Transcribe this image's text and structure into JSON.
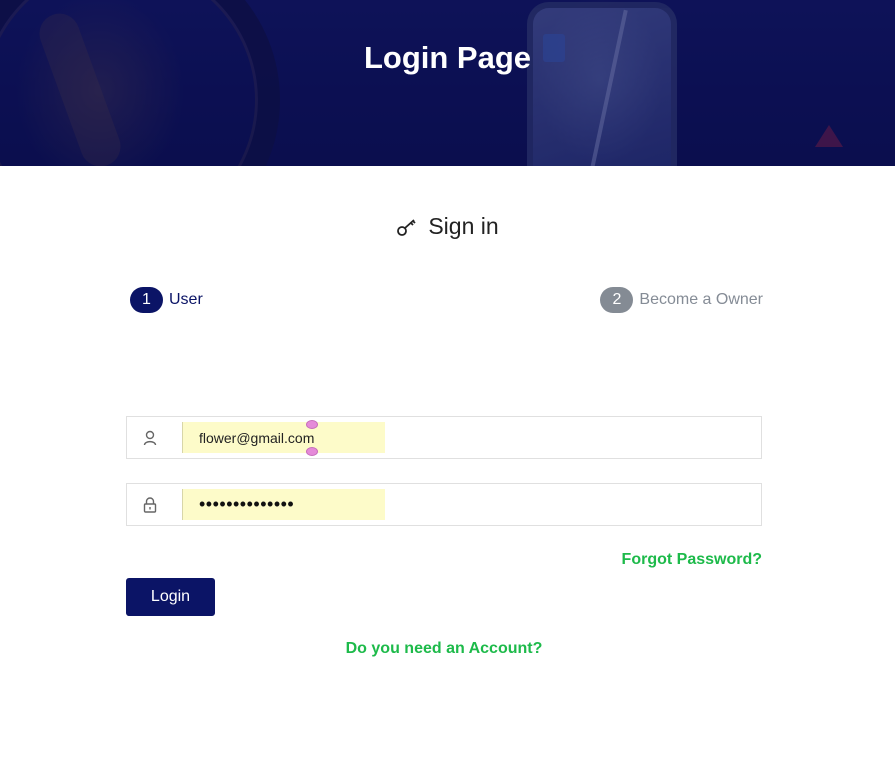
{
  "header": {
    "title": "Login Page"
  },
  "signin": {
    "heading": "Sign in",
    "icon": "key-icon"
  },
  "steps": [
    {
      "number": "1",
      "label": "User",
      "active": true
    },
    {
      "number": "2",
      "label": "Become a Owner",
      "active": false
    }
  ],
  "form": {
    "email": {
      "icon": "user-icon",
      "value": "flower@gmail.com"
    },
    "password": {
      "icon": "lock-icon",
      "value": "••••••••••••••"
    },
    "forgot_label": "Forgot Password?",
    "login_label": "Login",
    "signup_label": "Do you need an Account?"
  },
  "colors": {
    "primary": "#0b1466",
    "accent_green": "#1dba4a",
    "autofill": "#fdfbc9",
    "inactive_step": "#848b94"
  }
}
